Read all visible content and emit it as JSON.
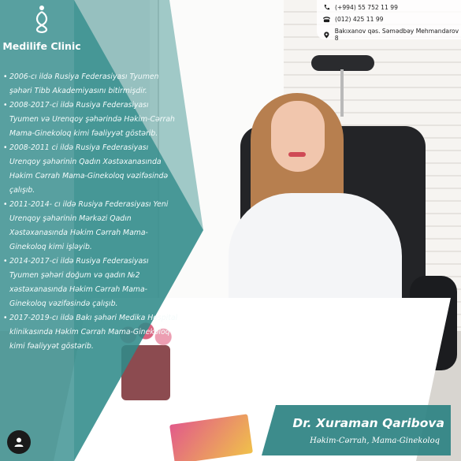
{
  "brand": {
    "name": "Medilife Clinic",
    "logo_icon": "medilife-logo-icon"
  },
  "contacts": {
    "phone_mobile": "(+994) 55 752 11 99",
    "phone_landline": "(012) 425 11 99",
    "address": "Bakıxanov qəs. Səmədbəy Mehmandarov 8"
  },
  "bio": [
    "2006-cı ildə Rusiya Federasiyası Tyumen şəhəri Tibb Akademiyasını bitirmişdir.",
    "2008-2017-ci ildə Rusiya Federasiyası Tyumen və Urenqoy şəhərində Həkim-Cərrah Mama-Ginekoloq kimi fəaliyyət göstərib.",
    "2008-2011 ci ildə Rusiya Federasiyası Urenqoy şəhərinin Qadın Xəstəxanasında Həkim Cərrah Mama-Ginekoloq vəzifəsində çalışıb.",
    "2011-2014- cı ildə Rusiya Federasiyası Yeni Urenqoy şəhərinin Mərkəzi Qadın Xəstəxanasında Həkim Cərrah Mama-Ginekoloq kimi işləyib.",
    "2014-2017-ci ildə Rusiya Federasiyası Tyumen şəhəri doğum və qadın №2 xəstəxanasında Həkim Cərrah Mama-Ginekoloq vəzifəsində çalışıb.",
    "2017-2019-cı ildə Bakı şəhəri Medika Hospital klinikasında Həkim Cərrah Mama-Ginekoloq kimi fəaliyyət göstərib."
  ],
  "doctor": {
    "name": "Dr. Xuraman Qaribova",
    "title": "Həkim-Cərrah, Mama-Ginekoloq"
  },
  "colors": {
    "teal": "#308b8a",
    "white": "#ffffff"
  },
  "icons": [
    "medilife-logo-icon",
    "phone-icon",
    "landline-icon",
    "location-pin-icon",
    "profile-icon"
  ]
}
